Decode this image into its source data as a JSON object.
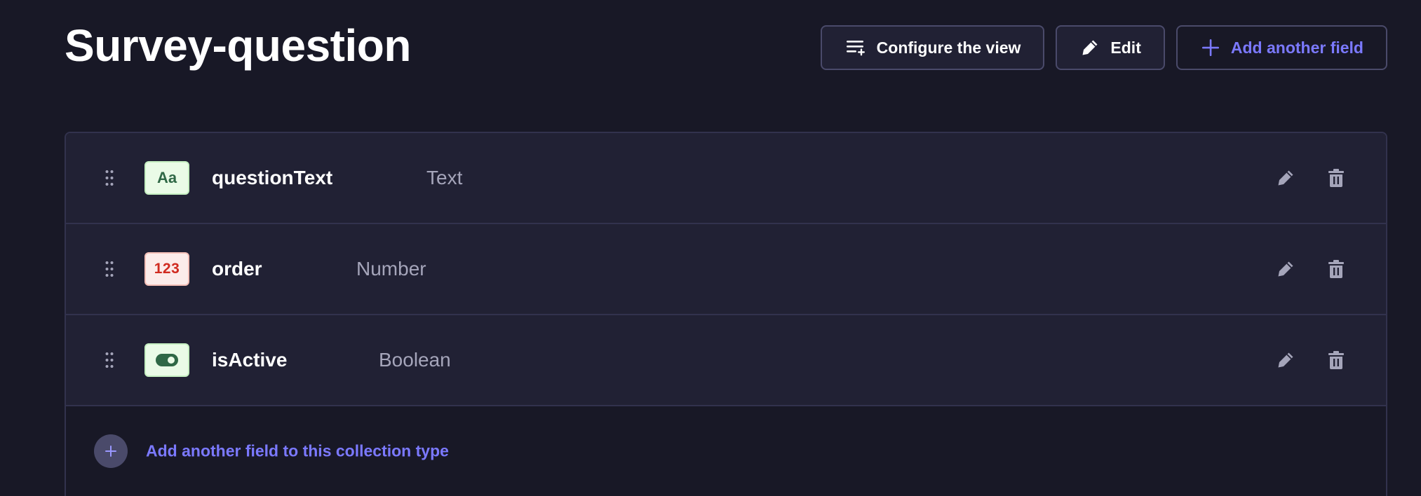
{
  "header": {
    "title": "Survey-question"
  },
  "toolbar": {
    "configure_label": "Configure the view",
    "configure_icon": "list-settings-icon",
    "edit_label": "Edit",
    "edit_icon": "pencil-icon",
    "add_field_label": "Add another field",
    "add_field_icon": "plus-icon"
  },
  "fields": [
    {
      "name": "questionText",
      "type": "Text",
      "badge": "Aa",
      "badge_kind": "text"
    },
    {
      "name": "order",
      "type": "Number",
      "badge": "123",
      "badge_kind": "number"
    },
    {
      "name": "isActive",
      "type": "Boolean",
      "badge": "",
      "badge_kind": "boolean"
    }
  ],
  "row_actions": {
    "edit_icon": "pencil-icon",
    "delete_icon": "trash-icon"
  },
  "footer": {
    "add_label": "Add another field to this collection type",
    "add_icon": "plus-circle-icon"
  },
  "colors": {
    "background": "#181826",
    "surface": "#212134",
    "border": "#32324d",
    "primary": "#7b79ff",
    "muted_text": "#a5a5ba"
  }
}
